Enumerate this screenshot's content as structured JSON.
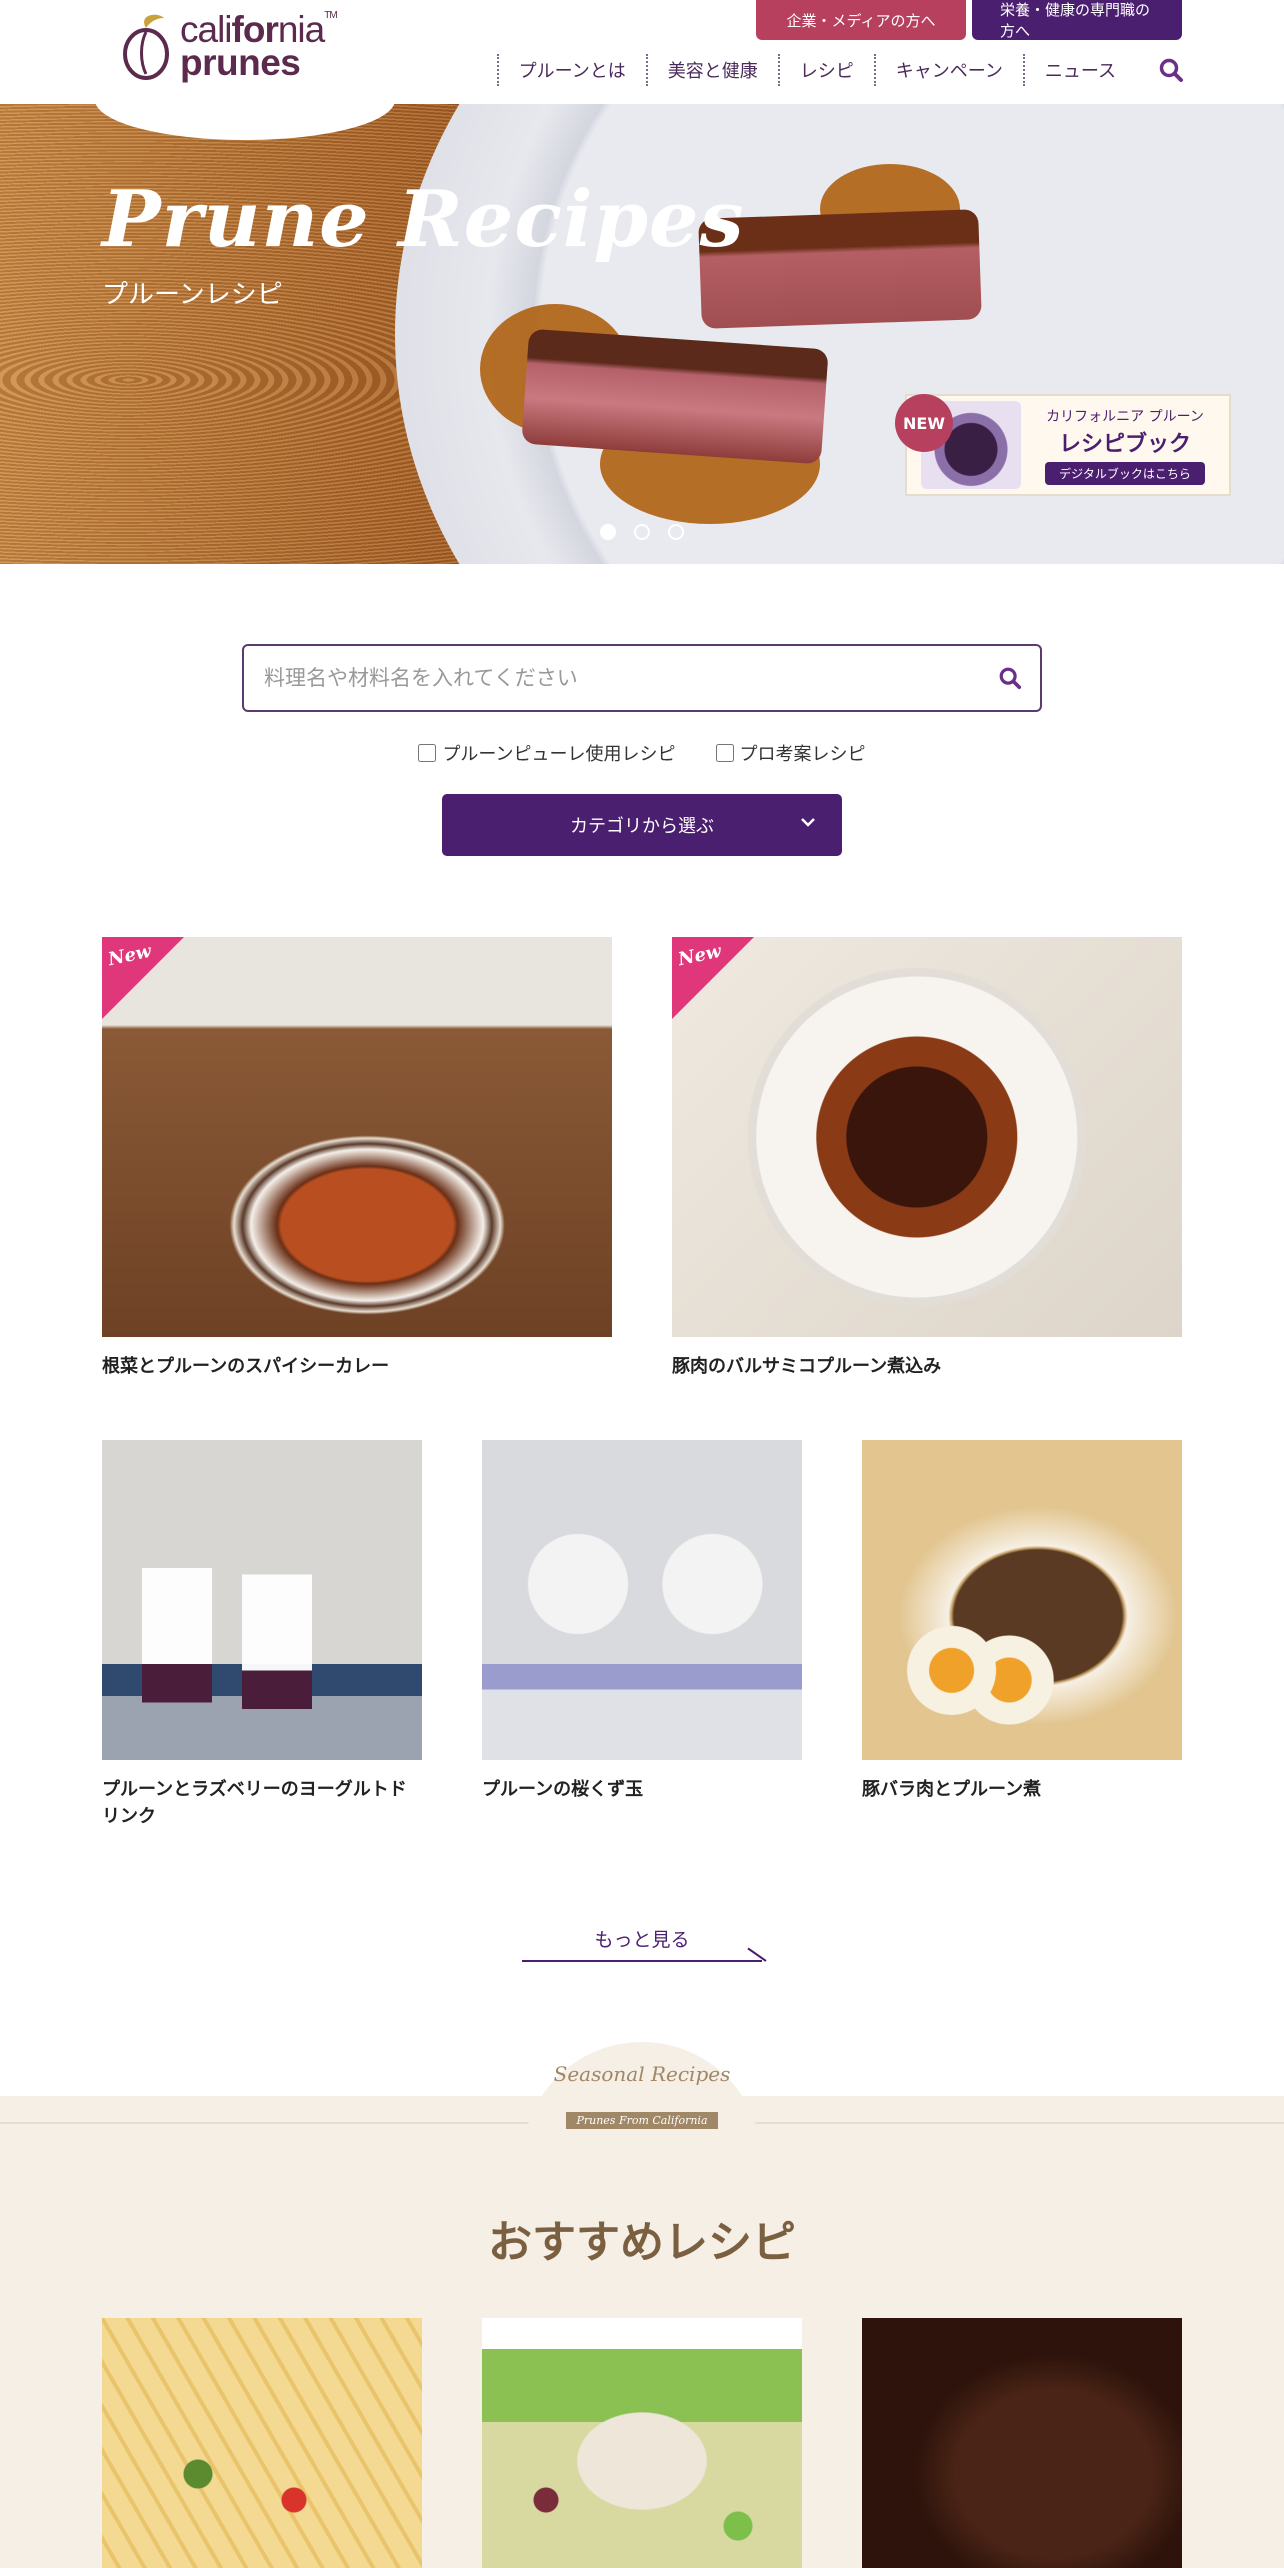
{
  "header": {
    "logo": {
      "line1_a": "cali",
      "line1_b": "for",
      "line1_c": "nia",
      "line2": "prunes",
      "tm": "TM"
    },
    "top_buttons": {
      "media": "企業・メディアの方へ",
      "pro": "栄養・健康の専門職の方へ"
    },
    "nav": [
      "プルーンとは",
      "美容と健康",
      "レシピ",
      "キャンペーン",
      "ニュース"
    ],
    "search_icon": "search-icon"
  },
  "hero": {
    "title": "Prune Recipes",
    "subtitle": "プルーンレシピ",
    "slides_total": 3,
    "active_slide": 1,
    "banner": {
      "badge": "NEW",
      "line1": "カリフォルニア プルーン",
      "line2": "レシピブック",
      "button": "デジタルブックはこちら"
    }
  },
  "search": {
    "placeholder": "料理名や材料名を入れてください",
    "value": "",
    "checkboxes": [
      {
        "label": "プルーンピューレ使用レシピ",
        "checked": false
      },
      {
        "label": "プロ考案レシピ",
        "checked": false
      }
    ],
    "category_button": "カテゴリから選ぶ"
  },
  "recipes": {
    "featured": [
      {
        "title": "根菜とプルーンのスパイシーカレー",
        "badge": "New"
      },
      {
        "title": "豚肉のバルサミコプルーン煮込み",
        "badge": "New"
      }
    ],
    "grid": [
      {
        "title": "プルーンとラズベリーのヨーグルトドリンク"
      },
      {
        "title": "プルーンの桜くず玉"
      },
      {
        "title": "豚バラ肉とプルーン煮"
      }
    ],
    "more": "もっと見る"
  },
  "seasonal": {
    "badge_script": "Seasonal Recipes",
    "badge_ribbon": "Prunes From California",
    "title": "おすすめレシピ"
  },
  "colors": {
    "brand_purple": "#4b1f6f",
    "media_red": "#b7405e",
    "new_pink": "#e0367a",
    "seasonal_bg": "#f5efe6",
    "seasonal_title": "#7a6041"
  }
}
